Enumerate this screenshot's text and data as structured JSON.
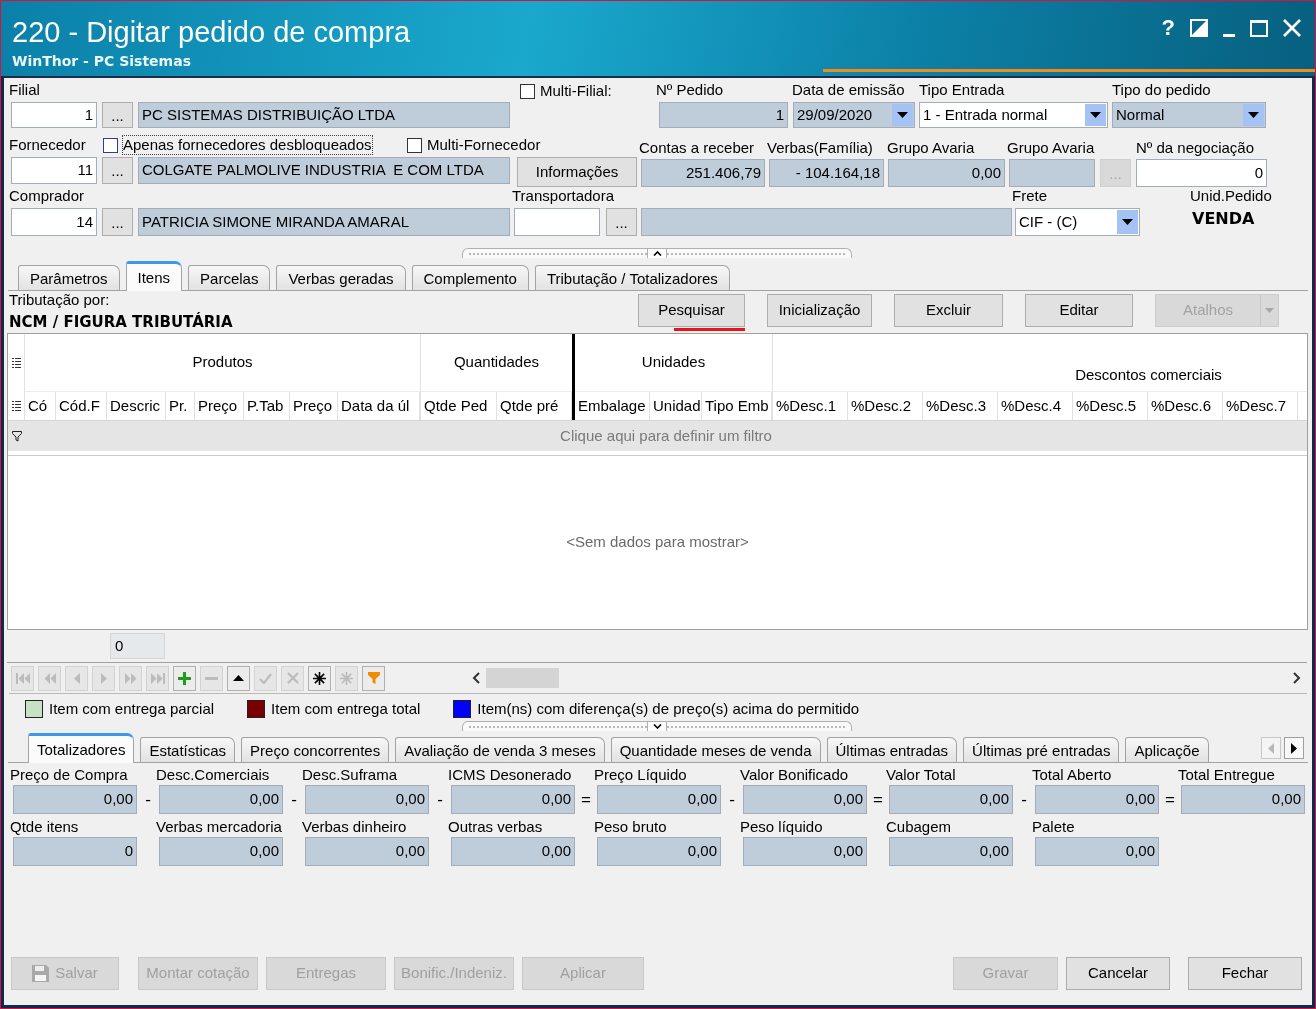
{
  "window": {
    "title": "220 - Digitar pedido de compra",
    "subtitle": "WinThor - PC Sistemas",
    "help": "?"
  },
  "header": {
    "filial": {
      "label": "Filial",
      "code": "1",
      "lookup": "...",
      "name": "PC SISTEMAS DISTRIBUIÇÃO LTDA"
    },
    "multi_filial": {
      "label": "Multi-Filial:",
      "checked": false
    },
    "numero_pedido": {
      "label": "Nº Pedido",
      "value": "1"
    },
    "data_emissao": {
      "label": "Data de emissão",
      "value": "29/09/2020"
    },
    "tipo_entrada": {
      "label": "Tipo Entrada",
      "value": "1 - Entrada normal"
    },
    "tipo_pedido": {
      "label": "Tipo do pedido",
      "value": "Normal"
    },
    "fornecedor": {
      "label": "Fornecedor",
      "code": "11",
      "lookup": "...",
      "name": "COLGATE PALMOLIVE INDUSTRIA  E COM LTDA"
    },
    "apenas_desbloqueados": {
      "label": "Apenas fornecedores desbloqueados",
      "checked": false,
      "focused": true
    },
    "multi_fornecedor": {
      "label": "Multi-Fornecedor",
      "checked": false
    },
    "informacoes": "Informações",
    "contas_receber": {
      "label": "Contas a receber",
      "value": "251.406,79"
    },
    "verbas_familia": {
      "label": "Verbas(Família)",
      "value": "- 104.164,18"
    },
    "grupo_avaria_valor": {
      "label": "Grupo Avaria",
      "value": "0,00"
    },
    "grupo_avaria": {
      "label": "Grupo Avaria",
      "lookup": "...",
      "disabled": true
    },
    "negociacao": {
      "label": "Nº da negociação",
      "value": "0"
    },
    "comprador": {
      "label": "Comprador",
      "code": "14",
      "lookup": "...",
      "name": "PATRICIA SIMONE MIRANDA AMARAL"
    },
    "transportadora": {
      "label": "Transportadora",
      "lookup": "..."
    },
    "frete": {
      "label": "Frete",
      "value": "CIF - (C)"
    },
    "unid_pedido": {
      "label": "Unid.Pedido",
      "value": "VENDA"
    }
  },
  "tabs": [
    {
      "label": "Parâmetros",
      "selected": false
    },
    {
      "label": "Itens",
      "selected": true
    },
    {
      "label": "Parcelas",
      "selected": false
    },
    {
      "label": "Verbas geradas",
      "selected": false
    },
    {
      "label": "Complemento",
      "selected": false
    },
    {
      "label": "Tributação / Totalizadores",
      "selected": false
    }
  ],
  "tributacao": {
    "label": "Tributação por:",
    "value": "NCM / FIGURA TRIBUTÁRIA"
  },
  "toolbar": [
    {
      "kind": "button",
      "label": "Pesquisar",
      "disabled": false,
      "highlighted": true
    },
    {
      "kind": "button",
      "label": "Inicialização",
      "disabled": false,
      "highlighted": false
    },
    {
      "kind": "button",
      "label": "Excluir",
      "disabled": false,
      "highlighted": false
    },
    {
      "kind": "button",
      "label": "Editar",
      "disabled": false,
      "highlighted": false
    },
    {
      "kind": "split",
      "label": "Atalhos",
      "disabled": true,
      "highlighted": false
    }
  ],
  "grid": {
    "bands": [
      {
        "label": "Produtos",
        "divider_after": false,
        "columns": [
          "Có",
          "Cód.F",
          "Descric",
          "Pr.",
          "Preço",
          "P.Tab",
          "Preço",
          "Data da úl"
        ]
      },
      {
        "label": "Quantidades",
        "divider_after": true,
        "columns": [
          "Qtde Ped",
          "Qtde pré"
        ]
      },
      {
        "label": "Unidades",
        "divider_after": false,
        "columns": [
          "Embalage",
          "Unidad",
          "Tipo Emb"
        ]
      },
      {
        "label": "Descontos comerciais",
        "divider_after": false,
        "columns": [
          "%Desc.1",
          "%Desc.2",
          "%Desc.3",
          "%Desc.4",
          "%Desc.5",
          "%Desc.6",
          "%Desc.7"
        ]
      }
    ],
    "filter_hint": "Clique aqui para definir um filtro",
    "empty_text": "<Sem dados para mostrar>",
    "footer_count": "0"
  },
  "navigator": [
    {
      "kind": "first",
      "disabled": true
    },
    {
      "kind": "prior_page",
      "disabled": true
    },
    {
      "kind": "prior",
      "disabled": true
    },
    {
      "kind": "next",
      "disabled": true
    },
    {
      "kind": "next_page",
      "disabled": true
    },
    {
      "kind": "last",
      "disabled": true
    },
    {
      "kind": "insert",
      "disabled": false
    },
    {
      "kind": "delete",
      "disabled": true
    },
    {
      "kind": "edit",
      "disabled": false
    },
    {
      "kind": "post",
      "disabled": true
    },
    {
      "kind": "cancel",
      "disabled": true
    },
    {
      "kind": "refresh",
      "disabled": false
    },
    {
      "kind": "bookmark",
      "disabled": true
    },
    {
      "kind": "filter",
      "disabled": false
    }
  ],
  "legend": [
    {
      "label": "Item com entrega parcial",
      "color": "#c6e2c6"
    },
    {
      "label": "Item com entrega total",
      "color": "#7a0000"
    },
    {
      "label": "Item(ns) com diferença(s) de preço(s) acima do permitido",
      "color": "#0000ff"
    }
  ],
  "bottom_tabs": [
    {
      "label": "Totalizadores",
      "selected": true
    },
    {
      "label": "Estatísticas",
      "selected": false
    },
    {
      "label": "Preço concorrentes",
      "selected": false
    },
    {
      "label": "Avaliação de venda 3 meses",
      "selected": false
    },
    {
      "label": "Quantidade meses de venda",
      "selected": false
    },
    {
      "label": "Últimas entradas",
      "selected": false
    },
    {
      "label": "Últimas pré entradas",
      "selected": false
    },
    {
      "label": "Aplicaçõe",
      "selected": false
    }
  ],
  "totals": [
    [
      {
        "label": "Preço de Compra",
        "value": "0,00",
        "operator": "-"
      },
      {
        "label": "Desc.Comerciais",
        "value": "0,00",
        "operator": "-"
      },
      {
        "label": "Desc.Suframa",
        "value": "0,00",
        "operator": "-"
      },
      {
        "label": "ICMS Desonerado",
        "value": "0,00",
        "operator": "="
      },
      {
        "label": "Preço Líquido",
        "value": "0,00",
        "operator": "-"
      },
      {
        "label": "Valor Bonificado",
        "value": "0,00",
        "operator": "="
      },
      {
        "label": "Valor Total",
        "value": "0,00",
        "operator": "-"
      },
      {
        "label": "Total Aberto",
        "value": "0,00",
        "operator": "="
      },
      {
        "label": "Total Entregue",
        "value": "0,00"
      }
    ],
    [
      {
        "label": "Qtde itens",
        "value": "0"
      },
      {
        "label": "Verbas mercadoria",
        "value": "0,00"
      },
      {
        "label": "Verbas dinheiro",
        "value": "0,00"
      },
      {
        "label": "Outras verbas",
        "value": "0,00"
      },
      {
        "label": "Peso bruto",
        "value": "0,00"
      },
      {
        "label": "Peso líquido",
        "value": "0,00"
      },
      {
        "label": "Cubagem",
        "value": "0,00"
      },
      {
        "label": "Palete",
        "value": "0,00"
      }
    ]
  ],
  "actions": {
    "left": [
      {
        "kind": "save",
        "label": "Salvar",
        "disabled": true
      },
      {
        "kind": "text",
        "label": "Montar cotação",
        "disabled": true
      },
      {
        "kind": "text",
        "label": "Entregas",
        "disabled": true
      },
      {
        "kind": "text",
        "label": "Bonific./Indeniz.",
        "disabled": true
      },
      {
        "kind": "text",
        "label": "Aplicar",
        "disabled": true
      }
    ],
    "right": [
      {
        "kind": "text",
        "label": "Gravar",
        "disabled": true
      },
      {
        "kind": "text",
        "label": "Cancelar",
        "disabled": false
      },
      {
        "kind": "text",
        "label": "Fechar",
        "disabled": false
      }
    ]
  }
}
